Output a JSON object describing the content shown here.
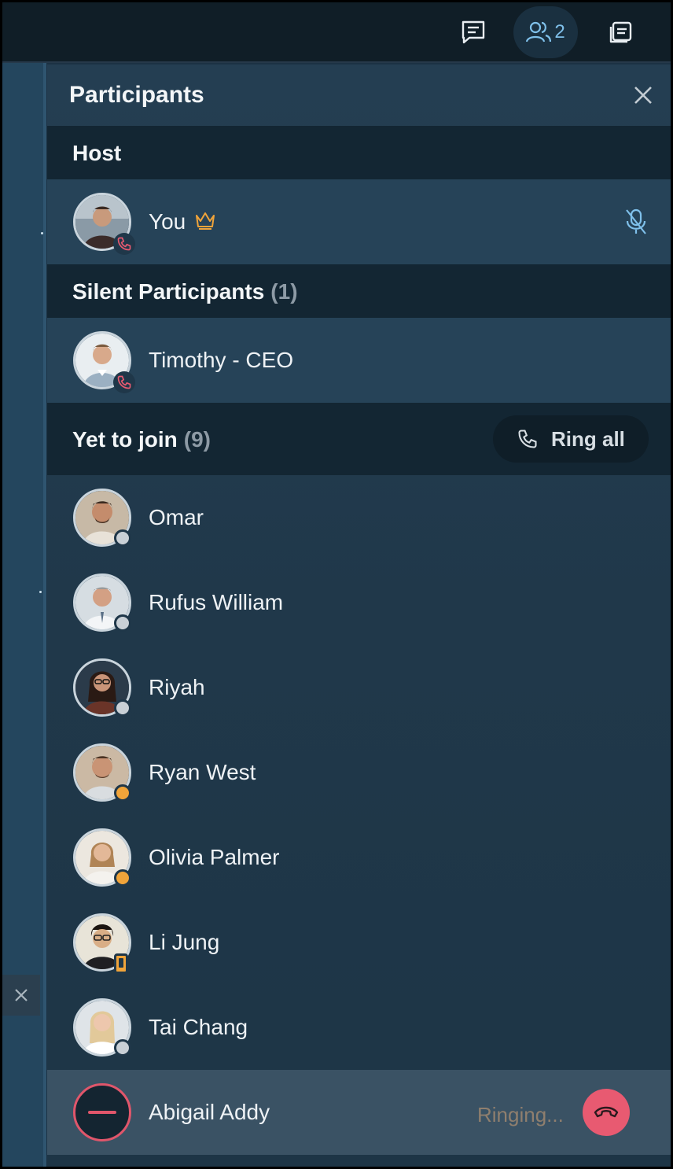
{
  "topbar": {
    "chat_icon": "chat-icon",
    "participants_icon": "participants-icon",
    "participants_count": "2",
    "whiteboard_icon": "whiteboard-icon",
    "accent": "#7fc0ea"
  },
  "panel": {
    "title": "Participants",
    "close_icon": "close-icon"
  },
  "host": {
    "section_title": "Host",
    "participant": {
      "name": "You",
      "crown_icon": "crown-icon",
      "status_icon": "phone-icon",
      "mute_icon": "mic-off-icon"
    }
  },
  "silent": {
    "section_title": "Silent Participants",
    "count": "(1)",
    "participants": [
      {
        "name": "Timothy - CEO",
        "status_icon": "phone-icon"
      }
    ]
  },
  "yet_to_join": {
    "section_title": "Yet to join",
    "count": "(9)",
    "ring_all_label": "Ring all",
    "participants": [
      {
        "name": "Omar",
        "status": "offline",
        "status_color": "#c9d0d6"
      },
      {
        "name": "Rufus William",
        "status": "offline",
        "status_color": "#c9d0d6"
      },
      {
        "name": "Riyah",
        "status": "offline",
        "status_color": "#c9d0d6"
      },
      {
        "name": "Ryan West",
        "status": "away",
        "status_color": "#f0a43a"
      },
      {
        "name": "Olivia Palmer",
        "status": "away",
        "status_color": "#f0a43a"
      },
      {
        "name": "Li Jung",
        "status": "mobile",
        "status_color": "#f0a43a"
      },
      {
        "name": "Tai Chang",
        "status": "offline",
        "status_color": "#c9d0d6"
      },
      {
        "name": "Abigail Addy",
        "status": "ringing",
        "ringing_label": "Ringing...",
        "hangup_icon": "hangup-icon"
      }
    ]
  },
  "colors": {
    "hangup": "#e85a71",
    "section_bg": "#132633",
    "panel_bg": "#203a4c"
  }
}
